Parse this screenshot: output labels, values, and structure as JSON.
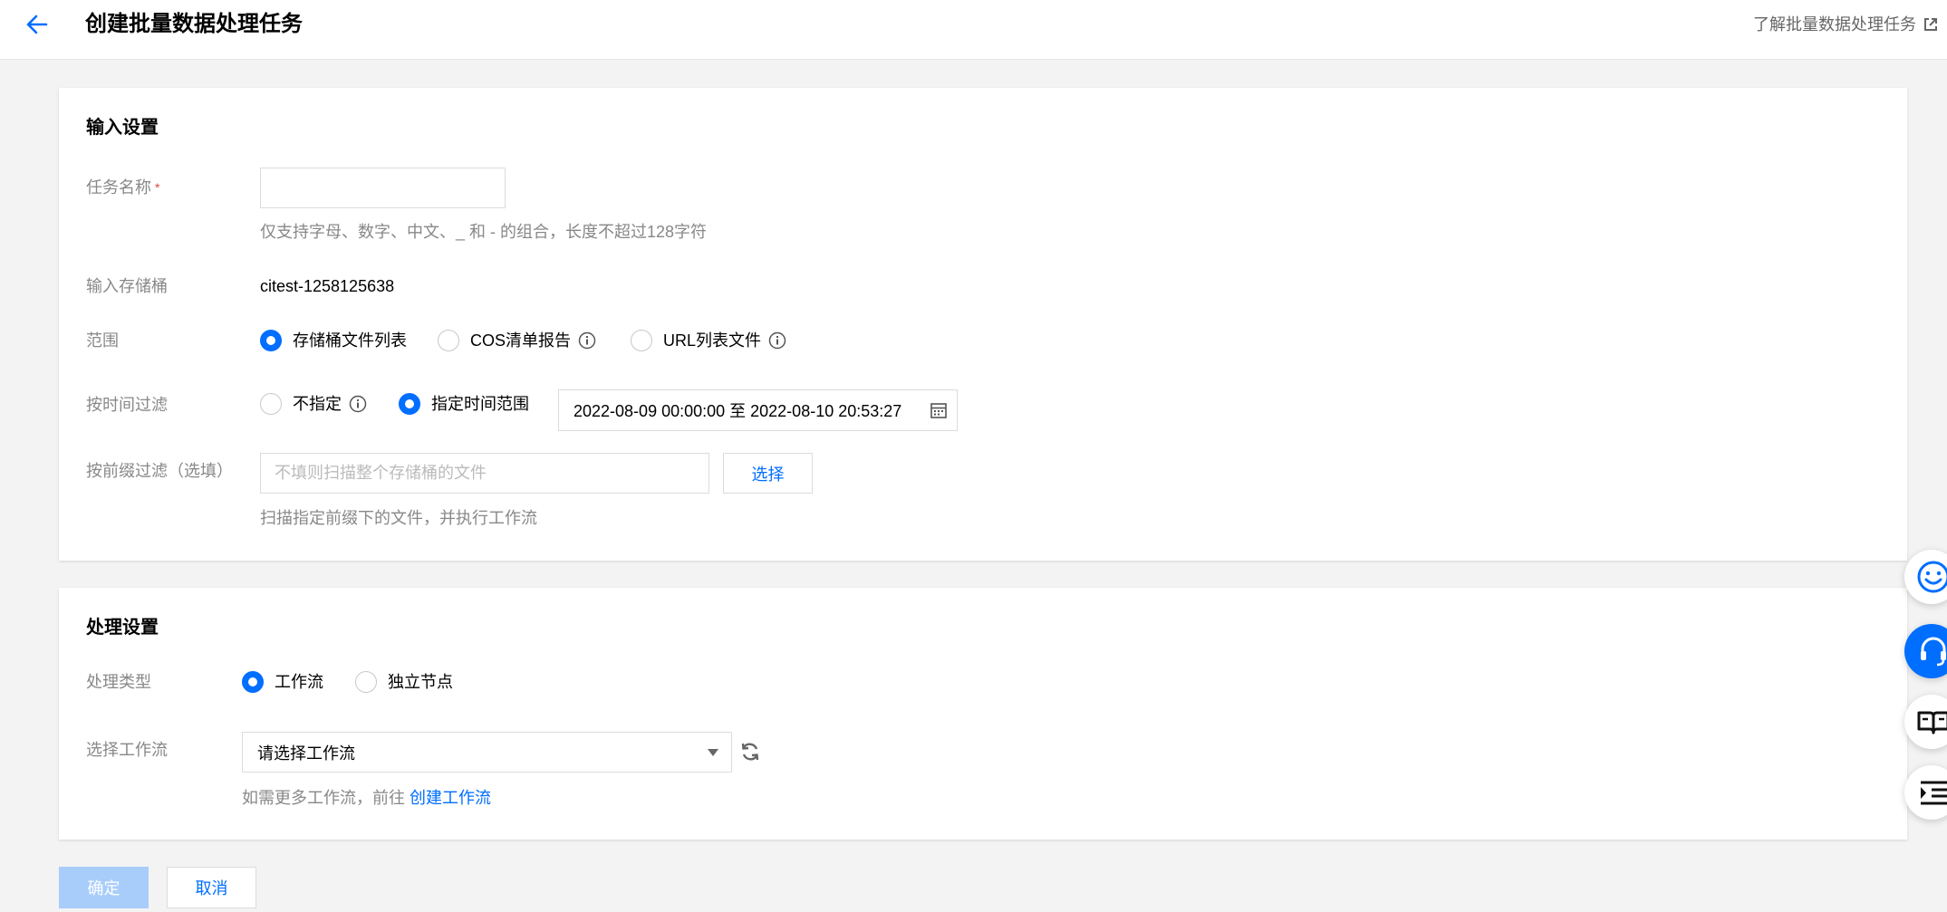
{
  "header": {
    "title": "创建批量数据处理任务",
    "doc_link": "了解批量数据处理任务"
  },
  "input_settings": {
    "section_title": "输入设置",
    "task_name": {
      "label": "任务名称",
      "value": "",
      "hint": "仅支持字母、数字、中文、_ 和 - 的组合，长度不超过128字符"
    },
    "bucket": {
      "label": "输入存储桶",
      "value": "citest-1258125638"
    },
    "scope": {
      "label": "范围",
      "options": [
        "存储桶文件列表",
        "COS清单报告",
        "URL列表文件"
      ],
      "selected": "存储桶文件列表"
    },
    "time_filter": {
      "label": "按时间过滤",
      "options": [
        "不指定",
        "指定时间范围"
      ],
      "selected": "指定时间范围",
      "range": "2022-08-09 00:00:00 至 2022-08-10 20:53:27"
    },
    "prefix_filter": {
      "label": "按前缀过滤（选填）",
      "placeholder": "不填则扫描整个存储桶的文件",
      "value": "",
      "button": "选择",
      "hint": "扫描指定前缀下的文件，并执行工作流"
    }
  },
  "process_settings": {
    "section_title": "处理设置",
    "type": {
      "label": "处理类型",
      "options": [
        "工作流",
        "独立节点"
      ],
      "selected": "工作流"
    },
    "workflow": {
      "label": "选择工作流",
      "selected": "请选择工作流",
      "hint_prefix": "如需更多工作流，前往",
      "hint_link": "创建工作流"
    }
  },
  "actions": {
    "confirm": "确定",
    "cancel": "取消"
  },
  "colors": {
    "primary": "#006eff",
    "confirm_disabled": "#a8cdfb",
    "required": "#e54545"
  },
  "float_tools": [
    "smile-icon",
    "headset-icon",
    "book-icon",
    "indent-icon"
  ]
}
